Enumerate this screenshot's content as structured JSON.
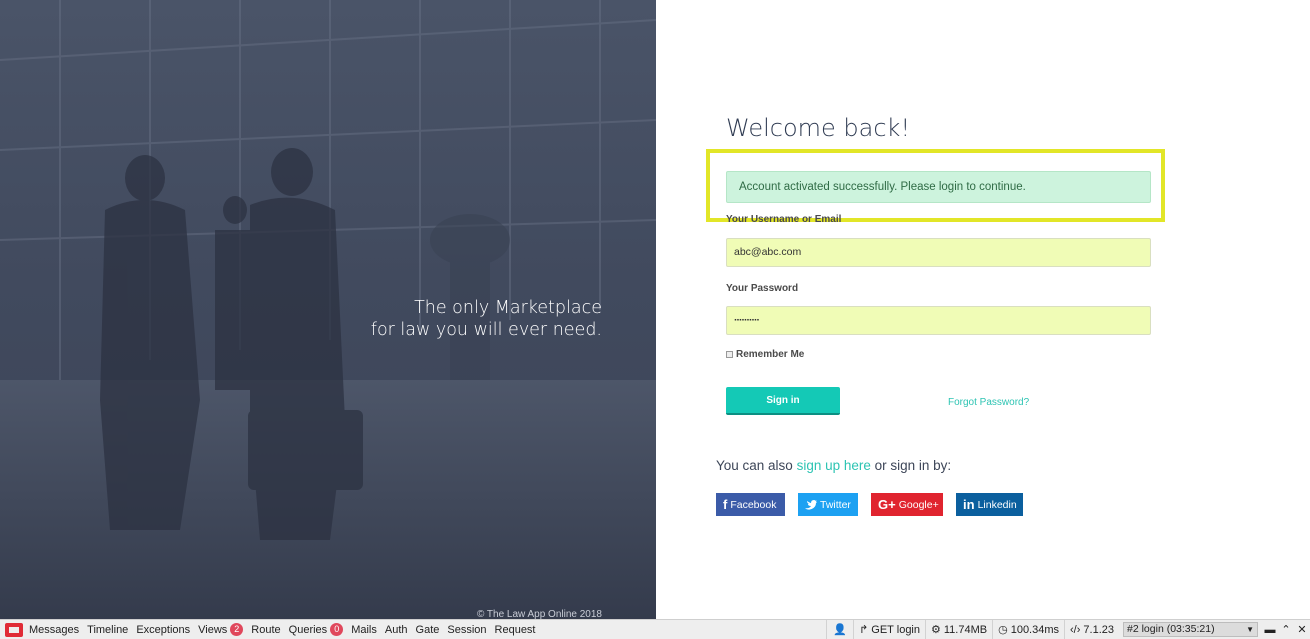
{
  "hero": {
    "tagline_line1": "The only Marketplace",
    "tagline_line2": "for law you will ever need.",
    "copyright": "© The Law App Online 2018"
  },
  "login": {
    "title": "Welcome back!",
    "alert": "Account activated successfully. Please login to continue.",
    "username_label": "Your Username or Email",
    "username_value": "abc@abc.com",
    "password_label": "Your Password",
    "password_value": "··········",
    "remember_label": "Remember Me",
    "signin_label": "Sign in",
    "forgot_label": "Forgot Password?",
    "also_prefix": "You can also ",
    "signup_link": "sign up here",
    "also_suffix": " or sign in by:"
  },
  "social": {
    "facebook": "Facebook",
    "twitter": "Twitter",
    "google": "Google+",
    "linkedin": "Linkedin"
  },
  "colors": {
    "accent": "#14c9b6",
    "highlight": "#e2e628",
    "alert_bg": "#cdf3dd",
    "input_bg": "#f0fcb6"
  },
  "debugbar": {
    "tabs": [
      "Messages",
      "Timeline",
      "Exceptions",
      "Views",
      "Route",
      "Queries",
      "Mails",
      "Auth",
      "Gate",
      "Session",
      "Request"
    ],
    "views_count": "2",
    "queries_count": "0",
    "request": "GET login",
    "memory": "11.74MB",
    "time": "100.34ms",
    "version": "7.1.23",
    "selected_request": "#2 login (03:35:21)"
  }
}
